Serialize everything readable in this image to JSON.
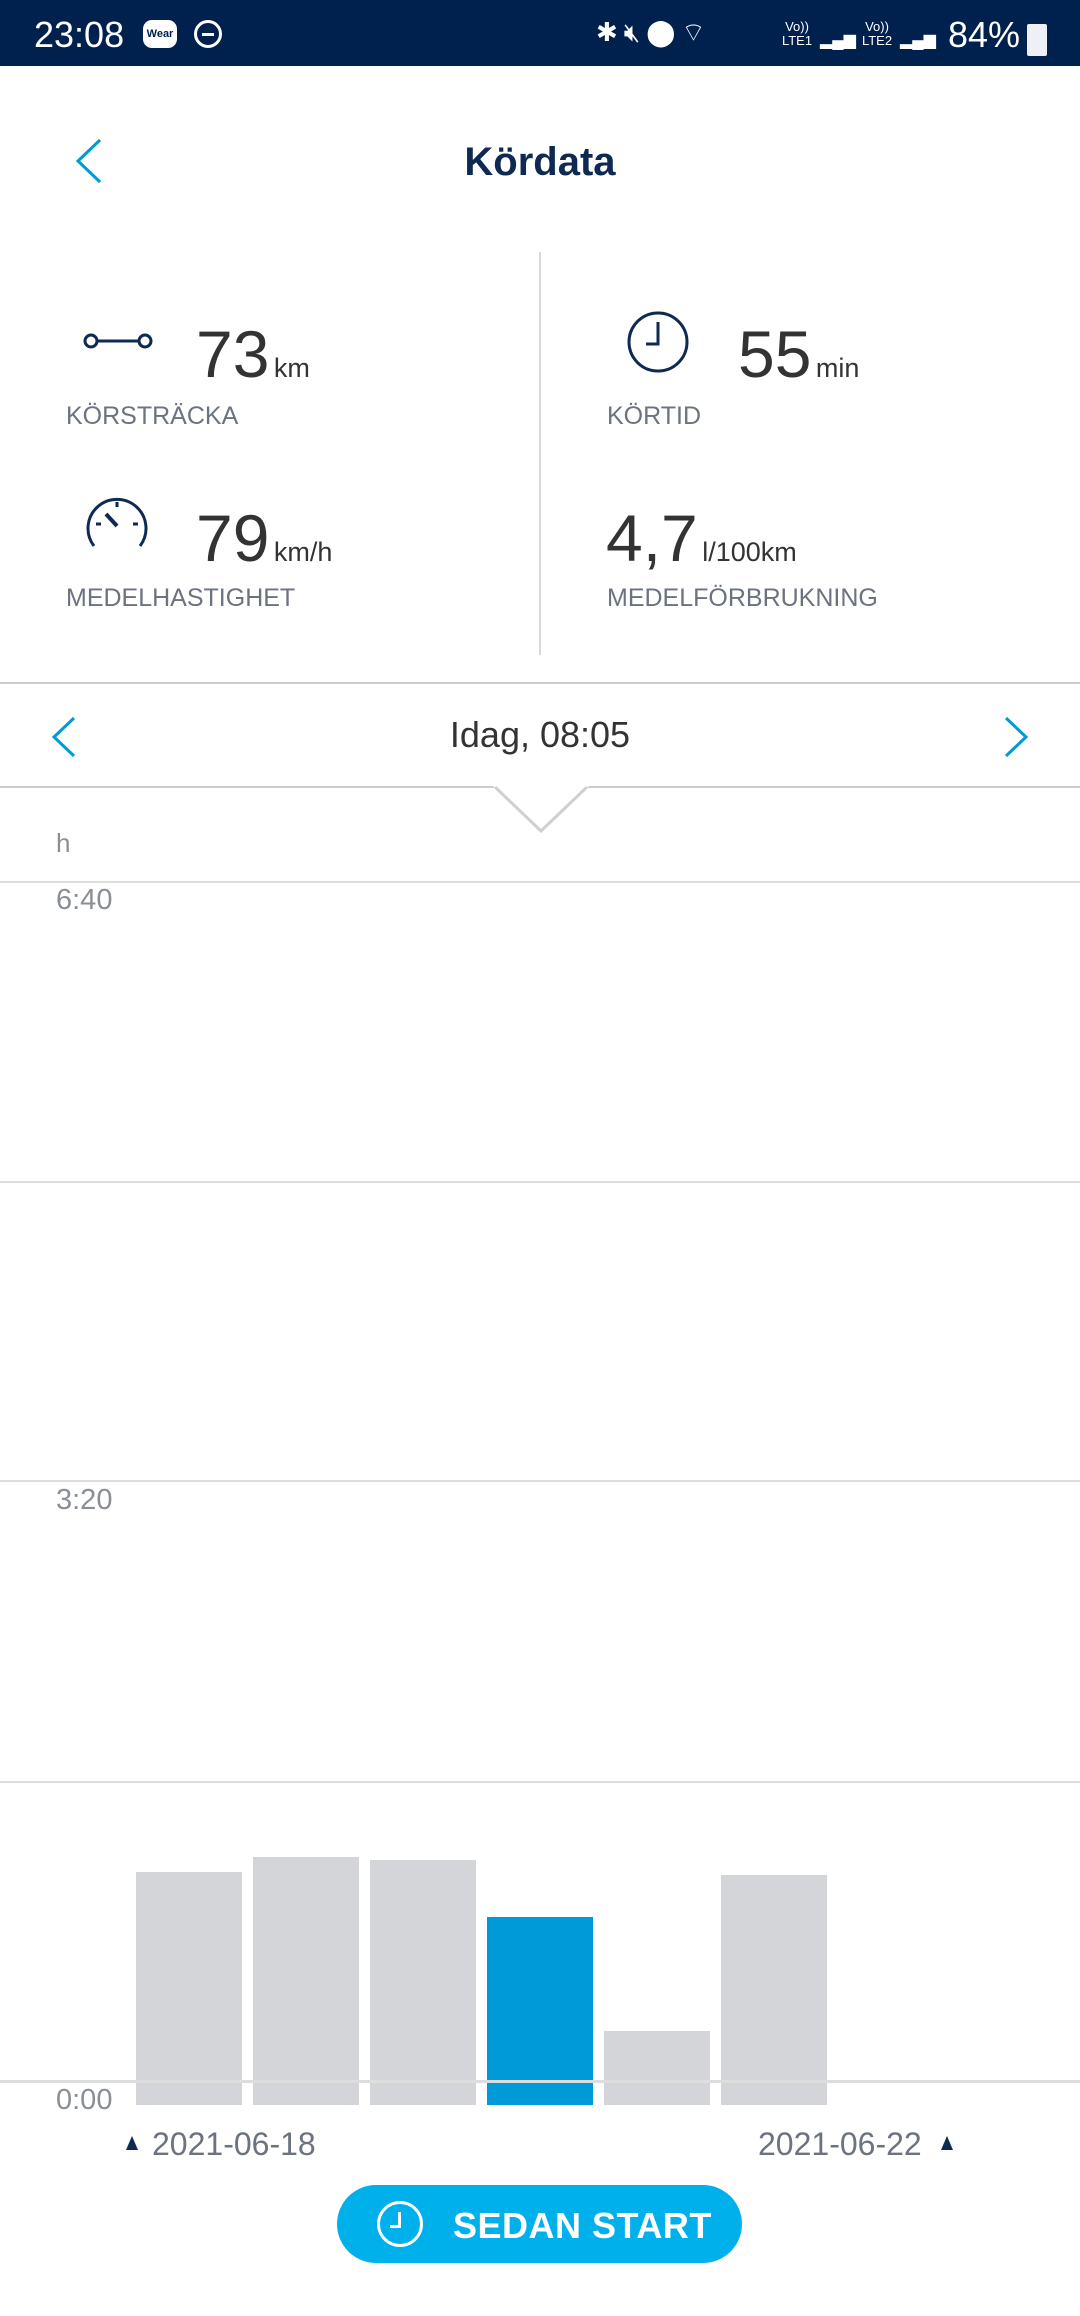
{
  "status_bar": {
    "time": "23:08",
    "wear_badge": "Wear",
    "icons": [
      "bluetooth-icon",
      "mute-icon",
      "location-icon",
      "wifi-icon",
      "lte1-signal-icon",
      "lte2-signal-icon"
    ],
    "lte1": "Vo)) LTE1",
    "lte2": "Vo)) LTE2",
    "battery": "84%"
  },
  "header": {
    "title": "Kördata"
  },
  "stats": {
    "distance": {
      "value": "73",
      "unit": "km",
      "label": "KÖRSTRÄCKA"
    },
    "time": {
      "value": "55",
      "unit": "min",
      "label": "KÖRTID"
    },
    "speed": {
      "value": "79",
      "unit": "km/h",
      "label": "MEDELHASTIGHET"
    },
    "consumption": {
      "value": "4,7",
      "unit": "l/100km",
      "label": "MEDELFÖRBRUKNING"
    }
  },
  "date_nav": {
    "current": "Idag, 08:05"
  },
  "colors": {
    "accent": "#009ad9",
    "bar": "#d4d5d9",
    "selected_bar": "#009ad9",
    "header_bg": "#00204e",
    "button": "#00b0ea"
  },
  "chart_data": {
    "type": "bar",
    "ylabel": "h",
    "ylim": [
      0,
      400
    ],
    "yticks": [
      {
        "value": 400,
        "label": "6:40"
      },
      {
        "value": 200,
        "label": "3:20"
      },
      {
        "value": 0,
        "label": "0:00"
      }
    ],
    "values_minutes": [
      70,
      75,
      74,
      55,
      17,
      69
    ],
    "selected_index": 3,
    "x_labels": {
      "start": "2021-06-18",
      "end": "2021-06-22"
    }
  },
  "button": {
    "label": "SEDAN START"
  }
}
